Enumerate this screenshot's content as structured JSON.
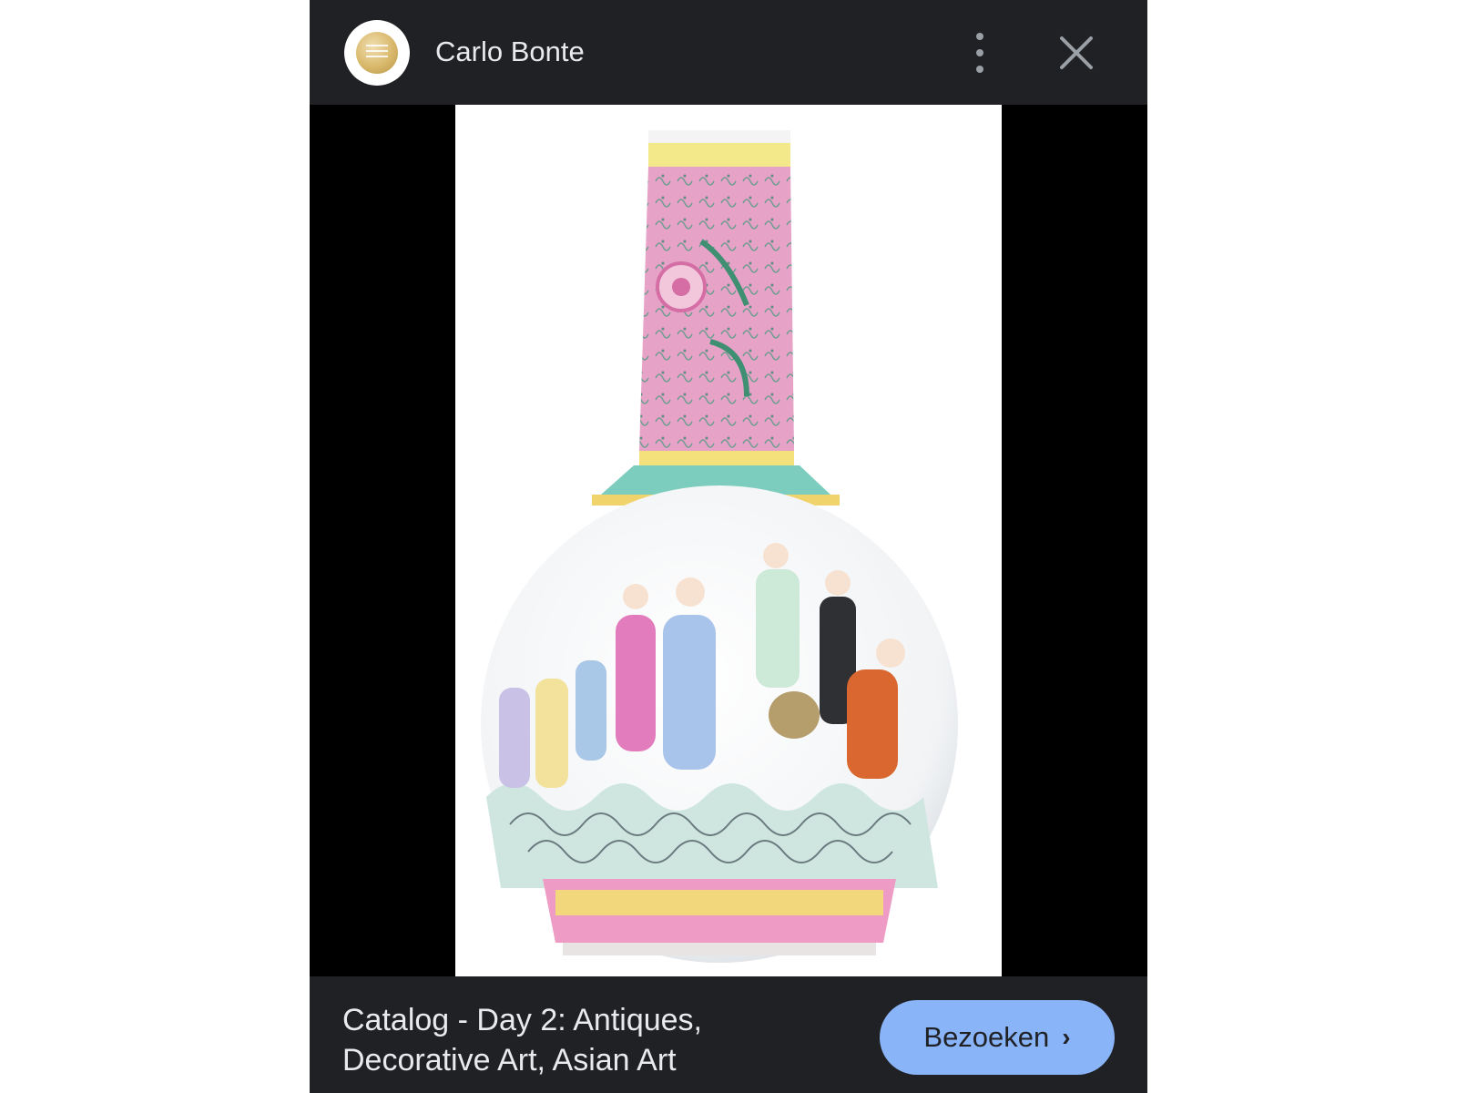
{
  "header": {
    "source_name": "Carlo Bonte",
    "more_icon": "more-vert-icon",
    "close_icon": "close-icon"
  },
  "image": {
    "subject": "porcelain-vase-icon"
  },
  "footer": {
    "caption": "Catalog - Day 2: Antiques, Decorative Art, Asian Art",
    "visit_label": "Bezoeken",
    "visit_icon": "chevron-right-icon"
  },
  "colors": {
    "bar_background": "#202124",
    "viewer_background": "#000000",
    "button_accent": "#8ab4f8",
    "text_light": "#e8eaed"
  }
}
